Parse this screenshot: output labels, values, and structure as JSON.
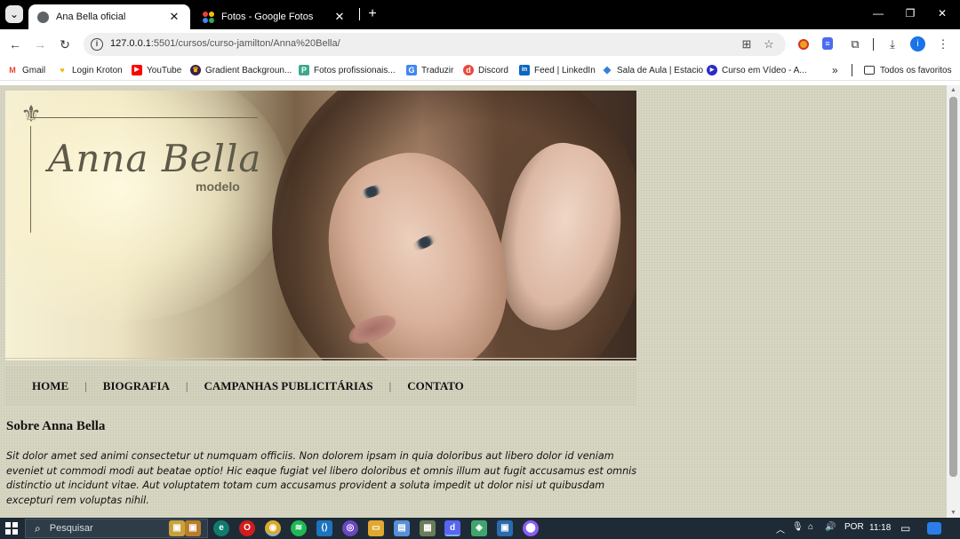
{
  "browser": {
    "tabs": [
      {
        "title": "Ana Bella oficial",
        "active": true
      },
      {
        "title": "Fotos - Google Fotos",
        "active": false
      }
    ],
    "url_host": "127.0.0.1",
    "url_path": ":5501/cursos/curso-jamilton/Anna%20Bella/",
    "profile_initial": "i",
    "bookmarks": [
      {
        "label": "Gmail",
        "icon": "gmail-icon",
        "color": "#ea4335",
        "glyph": "M"
      },
      {
        "label": "Login Kroton",
        "icon": "kroton-icon",
        "color": "#f4b400",
        "glyph": "♥"
      },
      {
        "label": "YouTube",
        "icon": "youtube-icon",
        "color": "#ff0000",
        "glyph": "▶"
      },
      {
        "label": "Gradient Backgroun...",
        "icon": "gradient-icon",
        "color": "#3a1f4d",
        "glyph": "♛"
      },
      {
        "label": "Fotos profissionais...",
        "icon": "photos-pro-icon",
        "color": "#3ea88f",
        "glyph": "P"
      },
      {
        "label": "Traduzir",
        "icon": "translate-icon",
        "color": "#4285f4",
        "glyph": "G"
      },
      {
        "label": "Discord",
        "icon": "discord-icon",
        "color": "#e84a3c",
        "glyph": "d"
      },
      {
        "label": "Feed | LinkedIn",
        "icon": "linkedin-icon",
        "color": "#0a66c2",
        "glyph": "in"
      },
      {
        "label": "Sala de Aula | Estacio",
        "icon": "estacio-icon",
        "color": "#3b7dd8",
        "glyph": "◆"
      },
      {
        "label": "Curso em Vídeo - A...",
        "icon": "cursoemvideo-icon",
        "color": "#2a2acb",
        "glyph": "▶"
      }
    ],
    "bookmarks_overflow": "»",
    "all_bookmarks": "Todos os favoritos"
  },
  "page": {
    "brand_name": "Anna Bella",
    "brand_sub": "modelo",
    "menu": [
      "HOME",
      "BIOGRAFIA",
      "CAMPANHAS PUBLICITÁRIAS",
      "CONTATO"
    ],
    "menu_separator": "|",
    "section_title": "Sobre Anna Bella",
    "paragraph": "Sit dolor amet sed animi consectetur ut numquam officiis. Non dolorem ipsam in quia doloribus aut libero dolor id veniam eveniet ut commodi modi aut beatae optio! Hic eaque fugiat vel libero doloribus et omnis illum aut fugit accusamus est omnis distinctio ut incidunt vitae. Aut voluptatem totam cum accusamus provident a soluta impedit ut dolor nisi ut quibusdam excepturi rem voluptas nihil."
  },
  "taskbar": {
    "search_placeholder": "Pesquisar",
    "language": "POR",
    "time": "11:18"
  },
  "colors": {
    "page_background": "#d7d6c3",
    "menu_text": "#111111",
    "brand_text": "#5e5a4a"
  }
}
